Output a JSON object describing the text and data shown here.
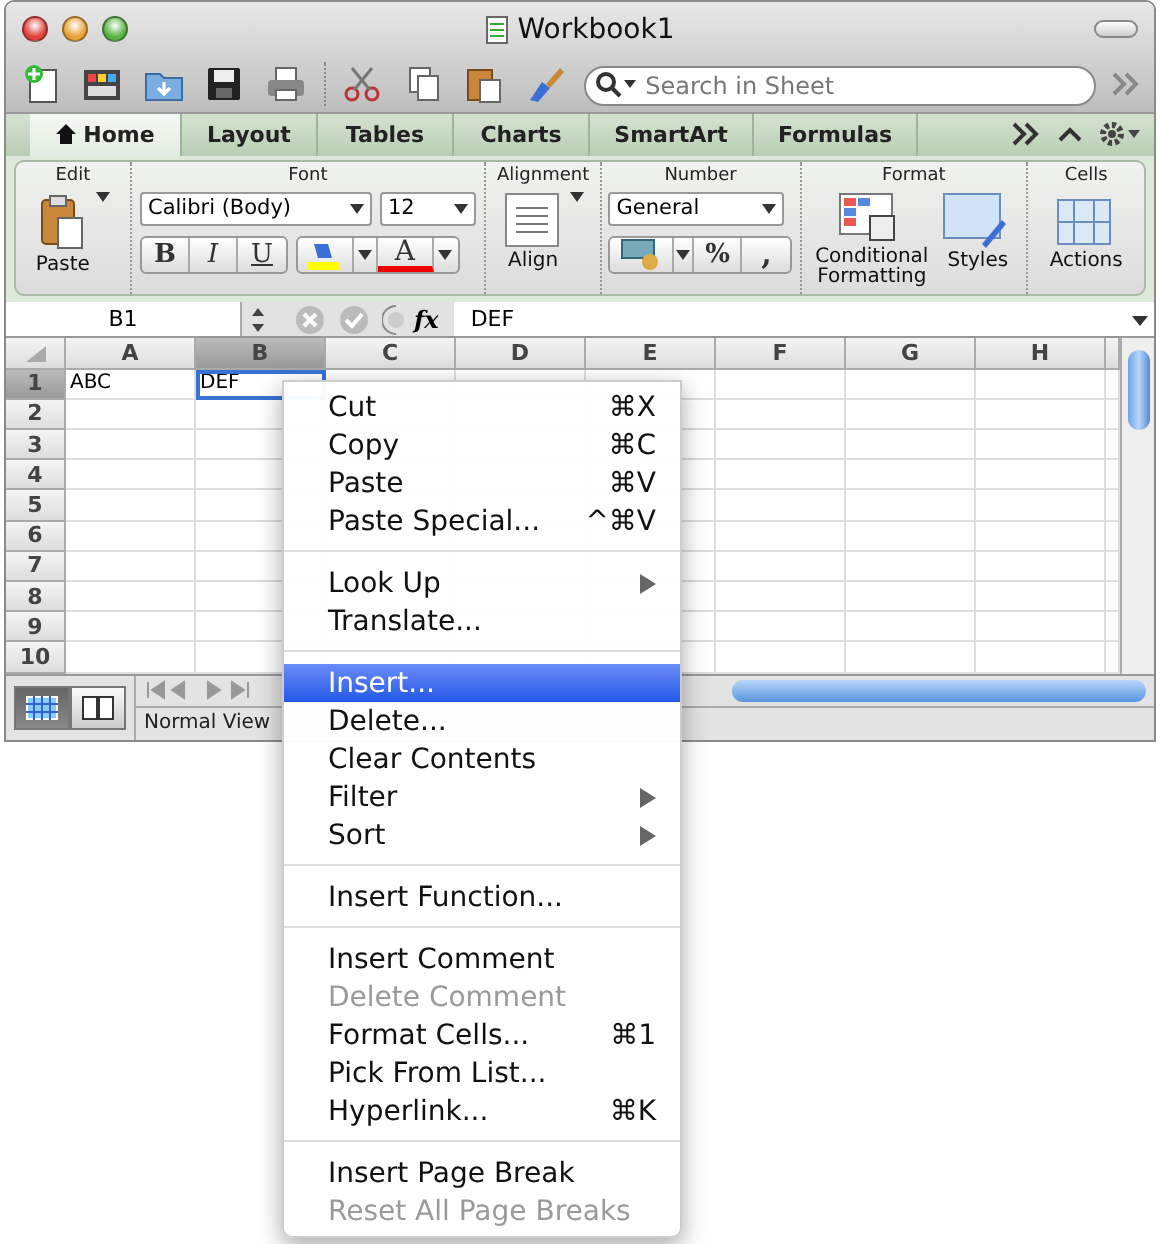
{
  "window": {
    "title": "Workbook1"
  },
  "toolbar": {
    "search": {
      "placeholder": "Search in Sheet"
    }
  },
  "ribbon_tabs": [
    {
      "label": "Home",
      "selected": true
    },
    {
      "label": "Layout",
      "selected": false
    },
    {
      "label": "Tables",
      "selected": false
    },
    {
      "label": "Charts",
      "selected": false
    },
    {
      "label": "SmartArt",
      "selected": false
    },
    {
      "label": "Formulas",
      "selected": false
    }
  ],
  "ribbon": {
    "edit": {
      "title": "Edit",
      "paste_label": "Paste"
    },
    "font": {
      "title": "Font",
      "font_name": "Calibri (Body)",
      "font_size": "12",
      "bold": "B",
      "italic": "I",
      "underline": "U",
      "font_color": "A"
    },
    "alignment": {
      "title": "Alignment",
      "align_label": "Align"
    },
    "number": {
      "title": "Number",
      "format": "General",
      "percent": "%",
      "comma": ","
    },
    "format": {
      "title": "Format",
      "conditional_label": "Conditional Formatting",
      "styles_label": "Styles"
    },
    "cells": {
      "title": "Cells",
      "actions_label": "Actions"
    }
  },
  "formula_bar": {
    "name_box": "B1",
    "fx": "fx",
    "value": "DEF"
  },
  "sheet": {
    "columns": [
      {
        "label": "A",
        "selected": false
      },
      {
        "label": "B",
        "selected": true
      },
      {
        "label": "C",
        "selected": false
      },
      {
        "label": "D",
        "selected": false
      },
      {
        "label": "E",
        "selected": false
      },
      {
        "label": "F",
        "selected": false
      },
      {
        "label": "G",
        "selected": false
      },
      {
        "label": "H",
        "selected": false
      }
    ],
    "rows": [
      {
        "label": "1",
        "selected": true,
        "cells": [
          {
            "value": "ABC",
            "selected": false
          },
          {
            "value": "DEF",
            "selected": true
          }
        ]
      },
      {
        "label": "2",
        "selected": false
      },
      {
        "label": "3",
        "selected": false
      },
      {
        "label": "4",
        "selected": false
      },
      {
        "label": "5",
        "selected": false
      },
      {
        "label": "6",
        "selected": false
      },
      {
        "label": "7",
        "selected": false
      },
      {
        "label": "8",
        "selected": false
      },
      {
        "label": "9",
        "selected": false
      },
      {
        "label": "10",
        "selected": false
      }
    ]
  },
  "status_bar": {
    "views": [
      {
        "kind": "normal",
        "selected": true
      },
      {
        "kind": "page-layout",
        "selected": false
      }
    ],
    "view_label": "Normal View"
  },
  "context_menu": {
    "items": [
      {
        "kind": "item",
        "label": "Cut",
        "shortcut": "⌘X",
        "selected": false,
        "disabled": false
      },
      {
        "kind": "item",
        "label": "Copy",
        "shortcut": "⌘C",
        "selected": false,
        "disabled": false
      },
      {
        "kind": "item",
        "label": "Paste",
        "shortcut": "⌘V",
        "selected": false,
        "disabled": false
      },
      {
        "kind": "item",
        "label": "Paste Special...",
        "shortcut": "^⌘V",
        "selected": false,
        "disabled": false
      },
      {
        "kind": "separator"
      },
      {
        "kind": "item",
        "label": "Look Up",
        "submenu": true,
        "selected": false,
        "disabled": false
      },
      {
        "kind": "item",
        "label": "Translate...",
        "selected": false,
        "disabled": false
      },
      {
        "kind": "separator"
      },
      {
        "kind": "item",
        "label": "Insert...",
        "selected": true,
        "disabled": false
      },
      {
        "kind": "item",
        "label": "Delete...",
        "selected": false,
        "disabled": false
      },
      {
        "kind": "item",
        "label": "Clear Contents",
        "selected": false,
        "disabled": false
      },
      {
        "kind": "item",
        "label": "Filter",
        "submenu": true,
        "selected": false,
        "disabled": false
      },
      {
        "kind": "item",
        "label": "Sort",
        "submenu": true,
        "selected": false,
        "disabled": false
      },
      {
        "kind": "separator"
      },
      {
        "kind": "item",
        "label": "Insert Function...",
        "selected": false,
        "disabled": false
      },
      {
        "kind": "separator"
      },
      {
        "kind": "item",
        "label": "Insert Comment",
        "selected": false,
        "disabled": false
      },
      {
        "kind": "item",
        "label": "Delete Comment",
        "selected": false,
        "disabled": true
      },
      {
        "kind": "item",
        "label": "Format Cells...",
        "shortcut": "⌘1",
        "selected": false,
        "disabled": false
      },
      {
        "kind": "item",
        "label": "Pick From List...",
        "selected": false,
        "disabled": false
      },
      {
        "kind": "item",
        "label": "Hyperlink...",
        "shortcut": "⌘K",
        "selected": false,
        "disabled": false
      },
      {
        "kind": "separator"
      },
      {
        "kind": "item",
        "label": "Insert Page Break",
        "selected": false,
        "disabled": false
      },
      {
        "kind": "item",
        "label": "Reset All Page Breaks",
        "selected": false,
        "disabled": true
      }
    ]
  }
}
